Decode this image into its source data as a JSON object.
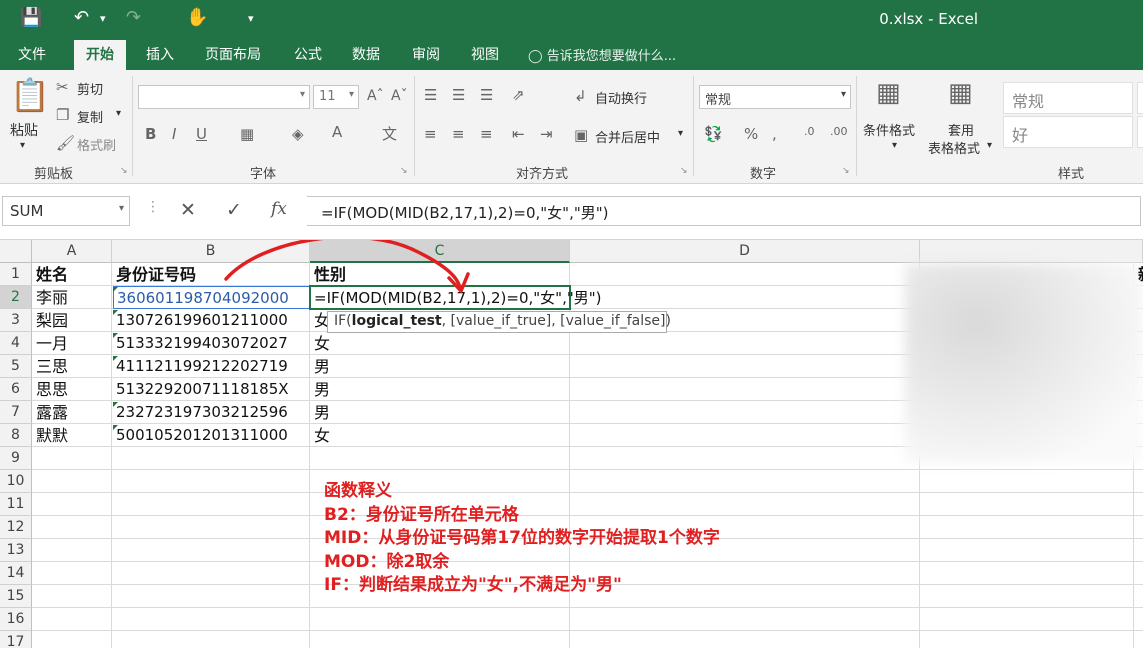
{
  "window": {
    "title": "0.xlsx - Excel"
  },
  "tabs": [
    "文件",
    "开始",
    "插入",
    "页面布局",
    "公式",
    "数据",
    "审阅",
    "视图"
  ],
  "active_tab": "开始",
  "tell_me": "告诉我您想要做什么...",
  "ribbon": {
    "clipboard": {
      "label": "剪贴板",
      "paste": "粘贴",
      "cut": "剪切",
      "copy": "复制",
      "format_painter": "格式刷"
    },
    "font": {
      "label": "字体",
      "size": "11"
    },
    "alignment": {
      "label": "对齐方式",
      "wrap": "自动换行",
      "merge": "合并后居中"
    },
    "number": {
      "label": "数字",
      "format": "常规"
    },
    "styles": {
      "label": "样式",
      "cond_format": "条件格式",
      "table_format_1": "套用",
      "table_format_2": "表格格式",
      "normal": "常规",
      "good": "好"
    }
  },
  "formula_bar": {
    "name_box": "SUM",
    "fx": "fx",
    "formula": "=IF(MOD(MID(B2,17,1),2)=0,\"女\",\"男\")"
  },
  "columns": [
    "A",
    "B",
    "C",
    "D"
  ],
  "rows": [
    "1",
    "2",
    "3",
    "4",
    "5",
    "6",
    "7",
    "8",
    "9",
    "10",
    "11",
    "12",
    "13",
    "14",
    "15",
    "16",
    "17"
  ],
  "cells": {
    "r1": [
      "姓名",
      "身份证号码",
      "性别"
    ],
    "r2": [
      "李丽",
      "360601198704092000",
      "=IF(MOD(MID(B2,17,1),2)=0,\"女\",\"男\")"
    ],
    "r3": [
      "梨园",
      "130726199601211000",
      "女"
    ],
    "r4": [
      "一月",
      "513332199403072027",
      "女"
    ],
    "r5": [
      "三思",
      "411121199212202719",
      "男"
    ],
    "r6": [
      "思思",
      "51322920071118185X",
      "男"
    ],
    "r7": [
      "露露",
      "232723197303212596",
      "男"
    ],
    "r8": [
      "默默",
      "500105201201311000",
      "女"
    ]
  },
  "tooltip": {
    "fn": "IF(",
    "arg1": "logical_test",
    "rest": ", [value_if_true], [value_if_false])"
  },
  "annotation": [
    "函数释义",
    "B2：身份证号所在单元格",
    "MID：从身份证号码第17位的数字开始提取1个数字",
    "MOD：除2取余",
    "IF：判断结果成立为\"女\",不满足为\"男\""
  ],
  "partial_right_char": "新",
  "colors": {
    "brand": "#217346",
    "annotation": "#e02020"
  }
}
